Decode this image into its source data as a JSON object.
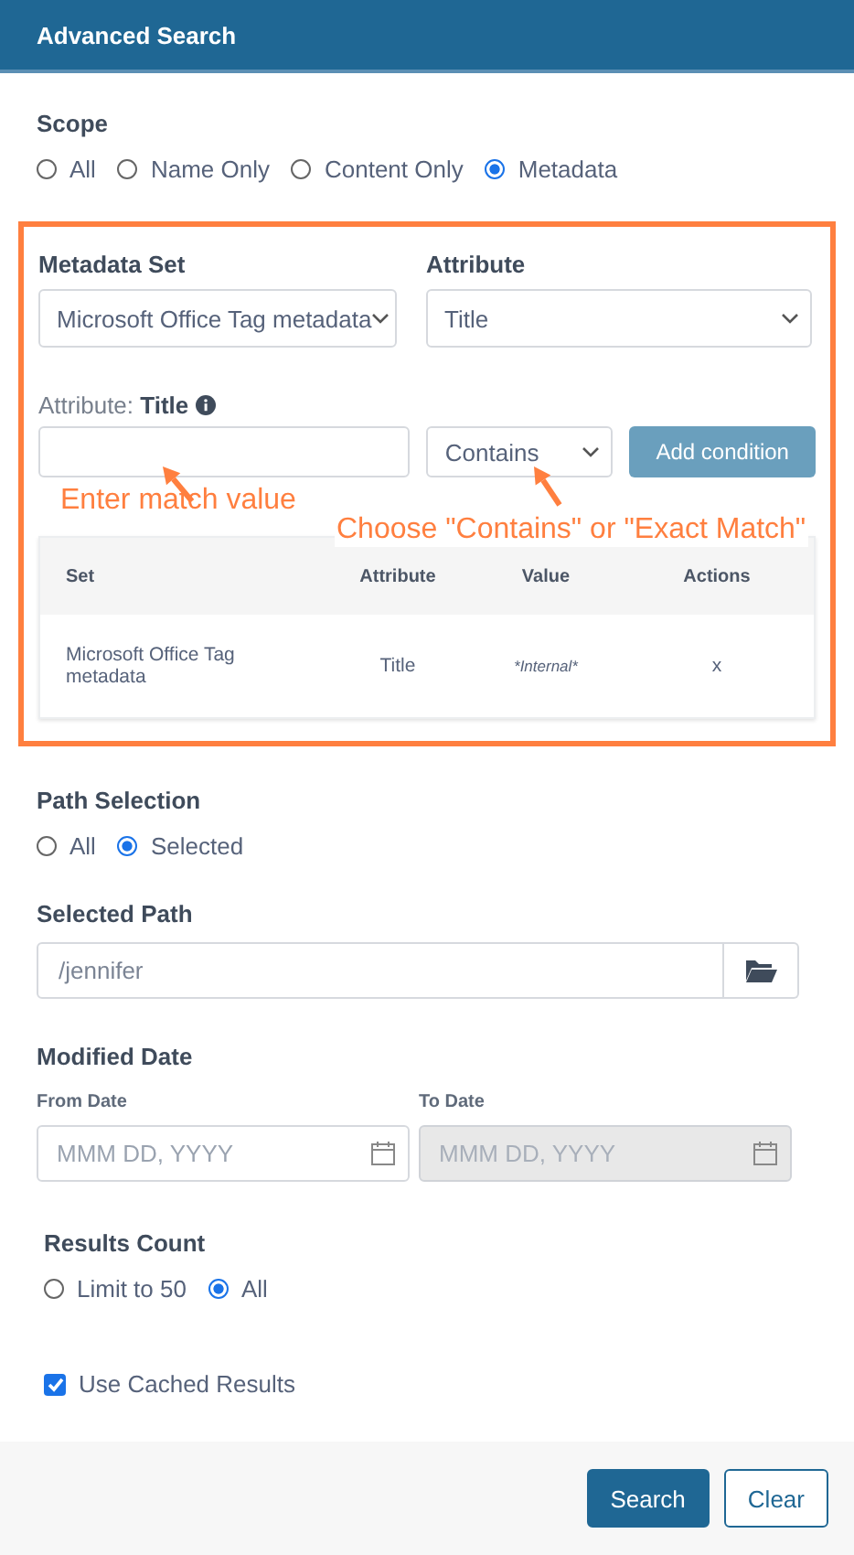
{
  "window": {
    "title": "Advanced Search"
  },
  "scope": {
    "label": "Scope",
    "options": [
      {
        "label": "All",
        "selected": false
      },
      {
        "label": "Name Only",
        "selected": false
      },
      {
        "label": "Content Only",
        "selected": false
      },
      {
        "label": "Metadata",
        "selected": true
      }
    ]
  },
  "metadata": {
    "set_label": "Metadata Set",
    "set_value": "Microsoft Office Tag metadata",
    "attribute_label": "Attribute",
    "attribute_value": "Title",
    "field_label": "Attribute: **Title**",
    "operator": "Contains",
    "add_button": "Add condition",
    "annotations": [
      {
        "text": "Enter match value"
      },
      {
        "text": "Choose \"Contains\" or \"Exact Match\""
      }
    ],
    "table": {
      "columns": [
        "Set",
        "Attribute",
        "Value",
        "Actions"
      ],
      "rows": [
        {
          "set": "Microsoft Office Tag metadata",
          "attribute": "Title",
          "value": "*Internal*",
          "action": "x"
        }
      ]
    }
  },
  "path_selection": {
    "label": "Path Selection",
    "options": [
      {
        "label": "All",
        "selected": false
      },
      {
        "label": "Selected",
        "selected": true
      }
    ]
  },
  "selected_path": {
    "label": "Selected Path",
    "value": "/jennifer"
  },
  "modified_date": {
    "label": "Modified Date",
    "fields": [
      {
        "label": "From Date",
        "placeholder": "MMM DD, YYYY",
        "disabled": false
      },
      {
        "label": "To Date",
        "placeholder": "MMM DD, YYYY",
        "disabled": true
      }
    ]
  },
  "results_count": {
    "label": "Results Count",
    "options": [
      {
        "label": "Limit to 50",
        "selected": false
      },
      {
        "label": "All",
        "selected": true
      }
    ]
  },
  "cached": {
    "label": "Use Cached Results",
    "checked": true
  },
  "buttons": [
    {
      "label": "Search",
      "kind": "primary"
    },
    {
      "label": "Clear",
      "kind": "secondary"
    }
  ]
}
